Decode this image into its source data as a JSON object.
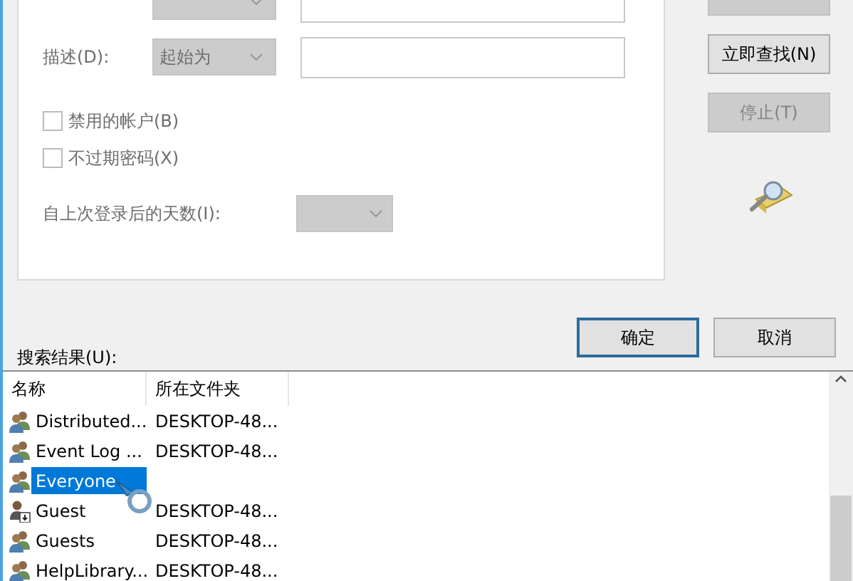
{
  "search_panel": {
    "fields": [
      {
        "kind": "cut_off"
      },
      {
        "kind": "full",
        "label": "描述(D):",
        "mode": "起始为"
      }
    ],
    "checkboxes": [
      {
        "label": "禁用的帐户(B)",
        "checked": false
      },
      {
        "label": "不过期密码(X)",
        "checked": false
      }
    ],
    "days_label": "自上次登录后的天数(I):"
  },
  "side_buttons": [
    {
      "disabled": true
    },
    {
      "label": "立即查找(N)",
      "disabled": false
    },
    {
      "label": "停止(T)",
      "disabled": true
    }
  ],
  "dialog_buttons": [
    {
      "label": "确定",
      "default": true
    },
    {
      "label": "取消",
      "default": false
    }
  ],
  "results": {
    "label": "搜索结果(U):",
    "columns": [
      "名称",
      "所在文件夹"
    ],
    "rows": [
      {
        "kind": "group",
        "name": "Distributed...",
        "folder": "DESKTOP-48...",
        "selected": false
      },
      {
        "kind": "group",
        "name": "Event Log ...",
        "folder": "DESKTOP-48...",
        "selected": false
      },
      {
        "kind": "group",
        "name": "Everyone",
        "selected": true
      },
      {
        "kind": "user",
        "name": "Guest",
        "folder": "DESKTOP-48...",
        "selected": false
      },
      {
        "kind": "group",
        "name": "Guests",
        "folder": "DESKTOP-48...",
        "selected": false
      },
      {
        "kind": "group",
        "name": "HelpLibrary...",
        "folder": "DESKTOP-48...",
        "selected": false
      }
    ]
  }
}
